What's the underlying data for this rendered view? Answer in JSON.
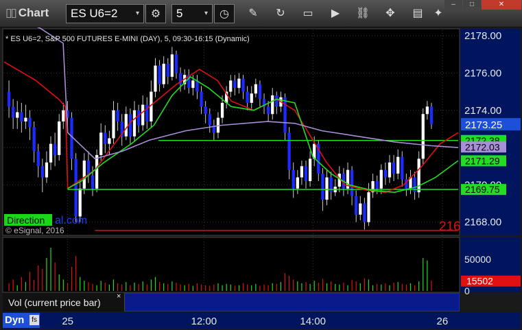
{
  "window": {
    "title": "Chart",
    "minimize": "–",
    "maximize": "□",
    "close": "✕"
  },
  "toolbar": {
    "symbol": "ES U6=2",
    "interval": "5",
    "icons": [
      "settings-icon",
      "clock-icon",
      "pencil-icon",
      "refresh-icon",
      "get-icon",
      "play-icon",
      "link-icon",
      "comment-icon",
      "twitter-icon"
    ]
  },
  "chart_data": {
    "type": "candlestick",
    "title": "* ES U6=2, S&P 500 FUTURES E-MINI (DAY), 5, 09:30-16:15 (Dynamic)",
    "copyright": "© eSignal, 2016",
    "watermark": "Direction",
    "watermark_suffix": "al.com",
    "ylim": [
      2167.4,
      2178.3
    ],
    "y_ticks": [
      "2178.00",
      "2176.00",
      "2174.00",
      "2172.00",
      "2170.00",
      "2168.00"
    ],
    "x_ticks": [
      {
        "label": "25",
        "pos": 0.14
      },
      {
        "label": "12:00",
        "pos": 0.44
      },
      {
        "label": "14:00",
        "pos": 0.68
      },
      {
        "label": "26",
        "pos": 0.965
      }
    ],
    "last_price": "2173.25",
    "level_labels": [
      {
        "value": 2172.38,
        "label": "2172.38",
        "color": "#22dd22"
      },
      {
        "value": 2172.03,
        "label": "2172.03",
        "color": "#a98fd8"
      },
      {
        "value": 2171.29,
        "label": "2171.29",
        "color": "#22dd22"
      },
      {
        "value": 2169.75,
        "label": "2169.75",
        "color": "#22dd22"
      }
    ],
    "levels": [
      {
        "value": 2172.38,
        "color": "#22dd22",
        "from": 0.34
      },
      {
        "value": 2169.75,
        "color": "#22dd22",
        "from": 0.14
      },
      {
        "value": 2167.55,
        "color": "#e01010",
        "from": 0.2
      }
    ],
    "offscreen_label": "216",
    "candles": [
      [
        2175.0,
        2174.2,
        2175.6,
        2173.6
      ],
      [
        2174.2,
        2173.6,
        2174.6,
        2173.0
      ],
      [
        2173.6,
        2173.9,
        2174.5,
        2173.0
      ],
      [
        2173.9,
        2173.4,
        2174.4,
        2172.8
      ],
      [
        2173.4,
        2173.6,
        2174.3,
        2173.0
      ],
      [
        2173.6,
        2173.1,
        2174.0,
        2172.4
      ],
      [
        2173.1,
        2171.8,
        2173.4,
        2171.2
      ],
      [
        2171.8,
        2171.0,
        2172.2,
        2170.4
      ],
      [
        2171.0,
        2170.4,
        2171.4,
        2169.6
      ],
      [
        2170.4,
        2171.2,
        2171.8,
        2170.1
      ],
      [
        2171.2,
        2172.2,
        2172.6,
        2170.8
      ],
      [
        2172.2,
        2171.6,
        2172.8,
        2171.0
      ],
      [
        2171.6,
        2173.4,
        2173.8,
        2171.3
      ],
      [
        2173.4,
        2174.0,
        2174.4,
        2173.0
      ],
      [
        2174.0,
        2173.6,
        2174.5,
        2173.1
      ],
      [
        2173.6,
        2171.4,
        2173.9,
        2170.8
      ],
      [
        2171.4,
        2168.3,
        2171.7,
        2168.0
      ],
      [
        2168.3,
        2169.8,
        2170.3,
        2168.0
      ],
      [
        2169.8,
        2171.3,
        2171.7,
        2169.5
      ],
      [
        2171.3,
        2170.5,
        2171.8,
        2170.1
      ],
      [
        2170.5,
        2169.8,
        2171.0,
        2169.4
      ],
      [
        2169.8,
        2171.6,
        2171.9,
        2169.6
      ],
      [
        2171.6,
        2172.8,
        2173.3,
        2171.3
      ],
      [
        2172.8,
        2172.2,
        2173.2,
        2171.7
      ],
      [
        2172.2,
        2172.5,
        2172.9,
        2171.6
      ],
      [
        2172.5,
        2174.0,
        2174.5,
        2172.2
      ],
      [
        2174.0,
        2173.4,
        2174.4,
        2172.9
      ],
      [
        2173.4,
        2172.6,
        2173.8,
        2172.1
      ],
      [
        2172.6,
        2173.8,
        2174.2,
        2172.4
      ],
      [
        2173.8,
        2172.6,
        2174.1,
        2172.2
      ],
      [
        2172.6,
        2174.0,
        2174.5,
        2172.3
      ],
      [
        2174.0,
        2173.2,
        2174.3,
        2172.8
      ],
      [
        2173.2,
        2174.3,
        2174.8,
        2172.9
      ],
      [
        2174.3,
        2173.4,
        2174.7,
        2173.0
      ],
      [
        2173.4,
        2175.0,
        2175.6,
        2173.1
      ],
      [
        2175.0,
        2176.4,
        2176.8,
        2174.7
      ],
      [
        2176.4,
        2175.4,
        2176.7,
        2175.0
      ],
      [
        2175.4,
        2176.5,
        2176.9,
        2175.2
      ],
      [
        2176.5,
        2175.8,
        2176.8,
        2175.4
      ],
      [
        2175.8,
        2177.0,
        2177.4,
        2175.6
      ],
      [
        2177.0,
        2176.0,
        2177.2,
        2175.7
      ],
      [
        2176.0,
        2175.4,
        2176.3,
        2175.0
      ],
      [
        2175.4,
        2175.9,
        2176.2,
        2175.1
      ],
      [
        2175.9,
        2175.2,
        2176.2,
        2174.9
      ],
      [
        2175.2,
        2175.6,
        2175.9,
        2174.8
      ],
      [
        2175.6,
        2175.0,
        2175.9,
        2174.6
      ],
      [
        2175.0,
        2174.2,
        2175.3,
        2173.8
      ],
      [
        2174.2,
        2173.8,
        2174.5,
        2173.3
      ],
      [
        2173.8,
        2173.2,
        2174.1,
        2172.8
      ],
      [
        2173.2,
        2172.8,
        2173.5,
        2172.4
      ],
      [
        2172.8,
        2173.6,
        2173.9,
        2172.5
      ],
      [
        2173.6,
        2174.4,
        2174.8,
        2173.3
      ],
      [
        2174.4,
        2175.0,
        2175.3,
        2174.1
      ],
      [
        2175.0,
        2175.6,
        2175.9,
        2174.7
      ],
      [
        2175.6,
        2175.2,
        2175.9,
        2174.8
      ],
      [
        2175.2,
        2175.7,
        2176.0,
        2174.9
      ],
      [
        2175.7,
        2175.0,
        2175.9,
        2174.6
      ],
      [
        2175.0,
        2174.4,
        2175.3,
        2174.0
      ],
      [
        2174.4,
        2174.9,
        2175.3,
        2174.1
      ],
      [
        2174.9,
        2175.4,
        2175.7,
        2174.7
      ],
      [
        2175.4,
        2174.6,
        2175.6,
        2174.2
      ],
      [
        2174.6,
        2174.2,
        2174.9,
        2173.8
      ],
      [
        2174.2,
        2173.8,
        2174.5,
        2173.4
      ],
      [
        2173.8,
        2174.8,
        2175.2,
        2173.5
      ],
      [
        2174.8,
        2174.2,
        2175.0,
        2173.8
      ],
      [
        2174.2,
        2174.7,
        2175.0,
        2173.9
      ],
      [
        2174.7,
        2172.8,
        2174.9,
        2172.4
      ],
      [
        2172.8,
        2170.8,
        2173.1,
        2170.3
      ],
      [
        2170.8,
        2169.8,
        2171.2,
        2169.3
      ],
      [
        2169.8,
        2170.4,
        2170.8,
        2169.5
      ],
      [
        2170.4,
        2171.0,
        2171.3,
        2170.0
      ],
      [
        2171.0,
        2170.2,
        2171.3,
        2169.8
      ],
      [
        2170.2,
        2171.4,
        2171.8,
        2169.9
      ],
      [
        2171.4,
        2172.2,
        2172.6,
        2171.0
      ],
      [
        2172.2,
        2170.6,
        2172.4,
        2170.2
      ],
      [
        2170.6,
        2169.2,
        2170.9,
        2168.6
      ],
      [
        2169.2,
        2170.4,
        2170.8,
        2168.9
      ],
      [
        2170.4,
        2169.6,
        2170.7,
        2169.2
      ],
      [
        2169.6,
        2169.9,
        2170.3,
        2169.4
      ],
      [
        2169.9,
        2170.6,
        2171.0,
        2169.6
      ],
      [
        2170.6,
        2169.8,
        2170.9,
        2169.4
      ],
      [
        2169.8,
        2170.8,
        2171.2,
        2169.5
      ],
      [
        2170.8,
        2169.4,
        2171.0,
        2168.9
      ],
      [
        2169.4,
        2168.4,
        2169.7,
        2168.0
      ],
      [
        2168.4,
        2169.0,
        2169.4,
        2168.1
      ],
      [
        2169.0,
        2168.0,
        2169.3,
        2167.6
      ],
      [
        2168.0,
        2169.6,
        2170.1,
        2167.8
      ],
      [
        2169.6,
        2170.2,
        2170.6,
        2169.3
      ],
      [
        2170.2,
        2169.8,
        2170.5,
        2169.5
      ],
      [
        2169.8,
        2170.8,
        2171.1,
        2169.5
      ],
      [
        2170.8,
        2170.4,
        2171.2,
        2170.0
      ],
      [
        2170.4,
        2171.2,
        2171.6,
        2170.1
      ],
      [
        2171.2,
        2170.6,
        2171.6,
        2170.2
      ],
      [
        2170.6,
        2171.5,
        2171.9,
        2170.3
      ],
      [
        2171.5,
        2170.3,
        2171.8,
        2169.9
      ],
      [
        2170.3,
        2169.8,
        2170.6,
        2169.4
      ],
      [
        2169.8,
        2170.4,
        2170.8,
        2169.5
      ],
      [
        2170.4,
        2169.6,
        2170.7,
        2169.2
      ],
      [
        2169.6,
        2171.4,
        2171.8,
        2169.3
      ],
      [
        2171.4,
        2173.8,
        2174.1,
        2171.1
      ],
      [
        2173.8,
        2174.2,
        2174.5,
        2173.5
      ],
      [
        2174.2,
        2173.25,
        2174.4,
        2173.0
      ]
    ],
    "lines": [
      {
        "name": "red",
        "color": "#e01010",
        "points": [
          [
            0,
            2176.6
          ],
          [
            0.07,
            2175.6
          ],
          [
            0.12,
            2174.6
          ],
          [
            0.135,
            2174.2
          ],
          [
            0.14,
            2169.8
          ],
          [
            0.2,
            2170.8
          ],
          [
            0.28,
            2173.4
          ],
          [
            0.38,
            2175.4
          ],
          [
            0.43,
            2176.2
          ],
          [
            0.47,
            2175.6
          ],
          [
            0.5,
            2174.5
          ],
          [
            0.55,
            2174.0
          ],
          [
            0.6,
            2174.6
          ],
          [
            0.64,
            2174.0
          ],
          [
            0.68,
            2172.4
          ],
          [
            0.71,
            2171.2
          ],
          [
            0.75,
            2170.0
          ],
          [
            0.8,
            2169.7
          ],
          [
            0.84,
            2169.6
          ],
          [
            0.88,
            2170.0
          ],
          [
            0.92,
            2171.0
          ],
          [
            0.96,
            2172.2
          ],
          [
            1,
            2172.8
          ]
        ]
      },
      {
        "name": "green",
        "color": "#22dd22",
        "points": [
          [
            0.14,
            2169.8
          ],
          [
            0.17,
            2170.2
          ],
          [
            0.22,
            2171.2
          ],
          [
            0.28,
            2172.2
          ],
          [
            0.33,
            2173.2
          ],
          [
            0.37,
            2174.8
          ],
          [
            0.41,
            2175.8
          ],
          [
            0.45,
            2175.2
          ],
          [
            0.5,
            2174.2
          ],
          [
            0.55,
            2174.0
          ],
          [
            0.6,
            2174.6
          ],
          [
            0.64,
            2174.4
          ],
          [
            0.68,
            2171.5
          ],
          [
            0.72,
            2170.6
          ],
          [
            0.76,
            2170.0
          ],
          [
            0.81,
            2169.7
          ],
          [
            0.86,
            2169.6
          ],
          [
            0.91,
            2169.9
          ],
          [
            0.95,
            2170.4
          ],
          [
            1,
            2171.3
          ]
        ]
      },
      {
        "name": "purple",
        "color": "#a98fd8",
        "points": [
          [
            0,
            2179.2
          ],
          [
            0.08,
            2178.4
          ],
          [
            0.13,
            2177.6
          ],
          [
            0.14,
            2172.8
          ],
          [
            0.2,
            2171.4
          ],
          [
            0.26,
            2171.8
          ],
          [
            0.32,
            2172.4
          ],
          [
            0.4,
            2172.9
          ],
          [
            0.48,
            2173.2
          ],
          [
            0.58,
            2173.4
          ],
          [
            0.64,
            2173.3
          ],
          [
            0.7,
            2172.9
          ],
          [
            0.78,
            2172.6
          ],
          [
            0.86,
            2172.3
          ],
          [
            0.94,
            2172.1
          ],
          [
            1,
            2172.0
          ]
        ]
      }
    ],
    "volume": {
      "ylim": [
        0,
        80000
      ],
      "y_ticks": [
        "50000",
        "0"
      ],
      "last": "15502",
      "bars": [
        12000,
        18000,
        9000,
        22000,
        14000,
        30000,
        17000,
        40000,
        35000,
        52000,
        68000,
        45000,
        26000,
        18000,
        12000,
        38000,
        55000,
        22000,
        16000,
        14000,
        11000,
        9000,
        16000,
        13000,
        10000,
        18000,
        12000,
        10000,
        14000,
        9000,
        13000,
        11000,
        15000,
        10000,
        18000,
        22000,
        14000,
        12000,
        11000,
        15000,
        13000,
        10000,
        9000,
        11000,
        8000,
        12000,
        10000,
        9000,
        8000,
        10000,
        12000,
        9000,
        11000,
        10000,
        8000,
        9000,
        12000,
        10000,
        9000,
        11000,
        8000,
        10000,
        9000,
        12000,
        11000,
        14000,
        28000,
        24000,
        18000,
        15000,
        12000,
        14000,
        11000,
        16000,
        13000,
        19000,
        12000,
        15000,
        11000,
        10000,
        13000,
        9000,
        17000,
        15000,
        12000,
        20000,
        18000,
        9000,
        11000,
        10000,
        12000,
        9000,
        13000,
        14000,
        11000,
        10000,
        12000,
        9000,
        15000,
        52000,
        48000,
        16000
      ]
    }
  },
  "bottom": {
    "indicator_label": "Vol (current price bar)",
    "indicator_close": "×",
    "dyn_label": "Dyn",
    "dyn_icon_label": "fs"
  }
}
